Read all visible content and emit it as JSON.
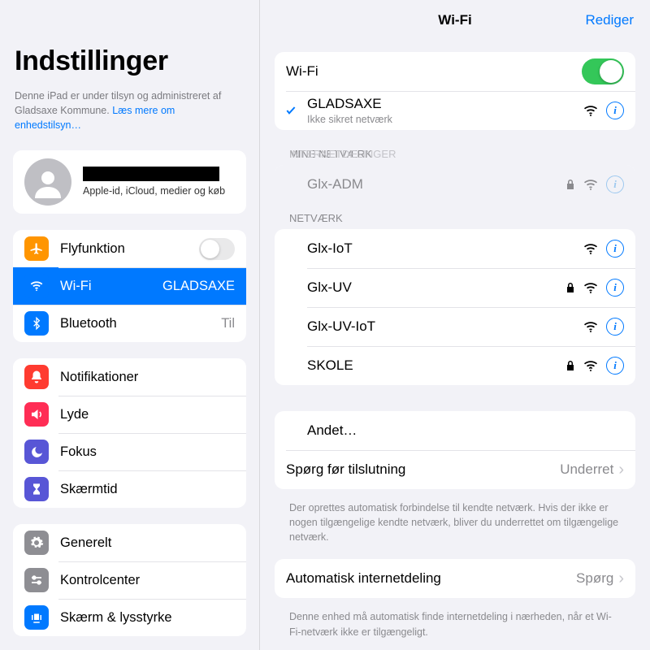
{
  "sidebar": {
    "title": "Indstillinger",
    "supervision_text": "Denne iPad er under tilsyn og administreret af Gladsaxe Kommune. ",
    "supervision_link": "Læs mere om enhedstilsyn…",
    "account_sub": "Apple-id, iCloud, medier og køb",
    "items": {
      "airplane": "Flyfunktion",
      "wifi": "Wi-Fi",
      "wifi_value": "GLADSAXE",
      "bluetooth": "Bluetooth",
      "bluetooth_value": "Til",
      "notifications": "Notifikationer",
      "sounds": "Lyde",
      "focus": "Fokus",
      "screentime": "Skærmtid",
      "general": "Generelt",
      "controlcenter": "Kontrolcenter",
      "display": "Skærm & lysstyrke"
    }
  },
  "detail": {
    "header_title": "Wi-Fi",
    "header_right": "Rediger",
    "wifi_label": "Wi-Fi",
    "wifi_on": true,
    "connected": {
      "name": "GLADSAXE",
      "security_note": "Ikke sikret netværk"
    },
    "section_my": "MINE NETVÆRK",
    "section_other_overlap": "INTERNETDELINGER",
    "section_networks": "NETVÆRK",
    "my_network": {
      "name": "Glx-ADM",
      "locked": true
    },
    "networks": [
      {
        "name": "Glx-IoT",
        "locked": false
      },
      {
        "name": "Glx-UV",
        "locked": true
      },
      {
        "name": "Glx-UV-IoT",
        "locked": false
      },
      {
        "name": "SKOLE",
        "locked": true
      }
    ],
    "other": "Andet…",
    "ask_label": "Spørg før tilslutning",
    "ask_value": "Underret",
    "ask_footer": "Der oprettes automatisk forbindelse til kendte netværk. Hvis der ikke er nogen tilgængelige kendte netværk, bliver du underrettet om tilgængelige netværk.",
    "hotspot_label": "Automatisk internetdeling",
    "hotspot_value": "Spørg",
    "hotspot_footer": "Denne enhed må automatisk finde internetdeling i nærheden, når et Wi-Fi-netværk ikke er tilgængeligt."
  }
}
